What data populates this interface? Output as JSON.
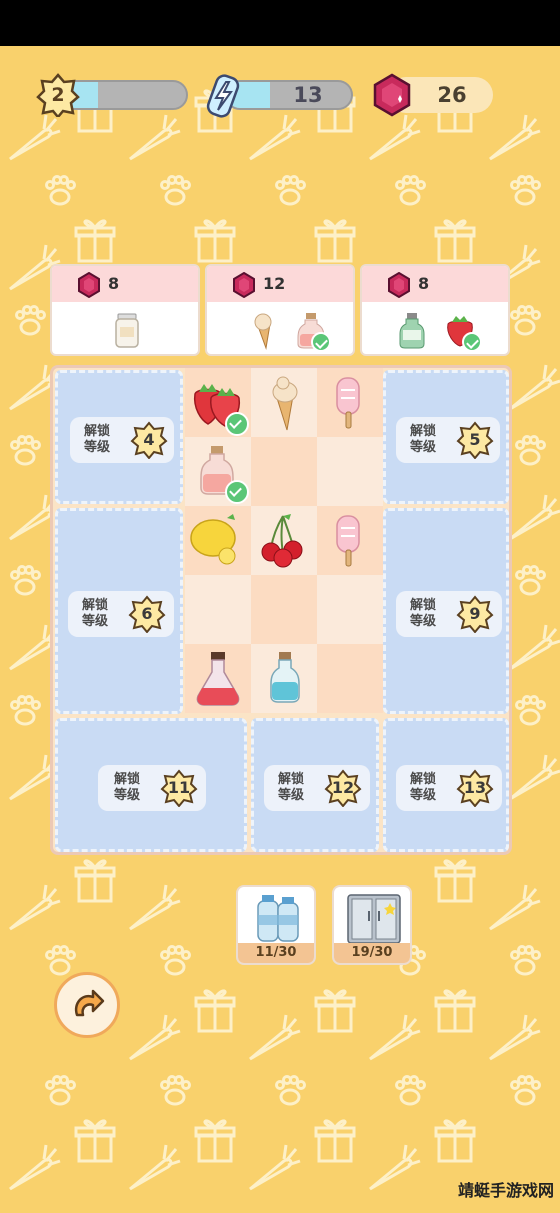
{
  "hud": {
    "level": "2",
    "level_progress": 0.3,
    "energy": "13",
    "energy_progress": 0.35,
    "gems": "26"
  },
  "orders": [
    {
      "reward": "8",
      "items": [
        "milk-jar"
      ],
      "done": [
        false
      ]
    },
    {
      "reward": "12",
      "items": [
        "ice-cream-cone",
        "pink-juice-bottle"
      ],
      "done": [
        false,
        true
      ]
    },
    {
      "reward": "8",
      "items": [
        "green-bottle",
        "strawberry"
      ],
      "done": [
        false,
        true
      ]
    }
  ],
  "lock_label": "解锁\n等级",
  "locks": [
    "4",
    "5",
    "6",
    "9",
    "11",
    "12",
    "13"
  ],
  "board_items": [
    "strawberry",
    "ice-cream-cone",
    "strawberry-popsicle",
    "pink-juice-bottle",
    "lemon",
    "cherries",
    "strawberry-popsicle",
    "red-potion-flask",
    "blue-potion-bottle"
  ],
  "tools": [
    {
      "name": "water-bottles",
      "count": "11/30"
    },
    {
      "name": "refrigerator",
      "count": "19/30"
    }
  ],
  "watermark": "靖蜓手游戏网",
  "colors": {
    "background": "#f9d16c",
    "locked_tile": "#c9dbf4",
    "order_header": "#fcd9d9",
    "check": "#5bc677"
  }
}
